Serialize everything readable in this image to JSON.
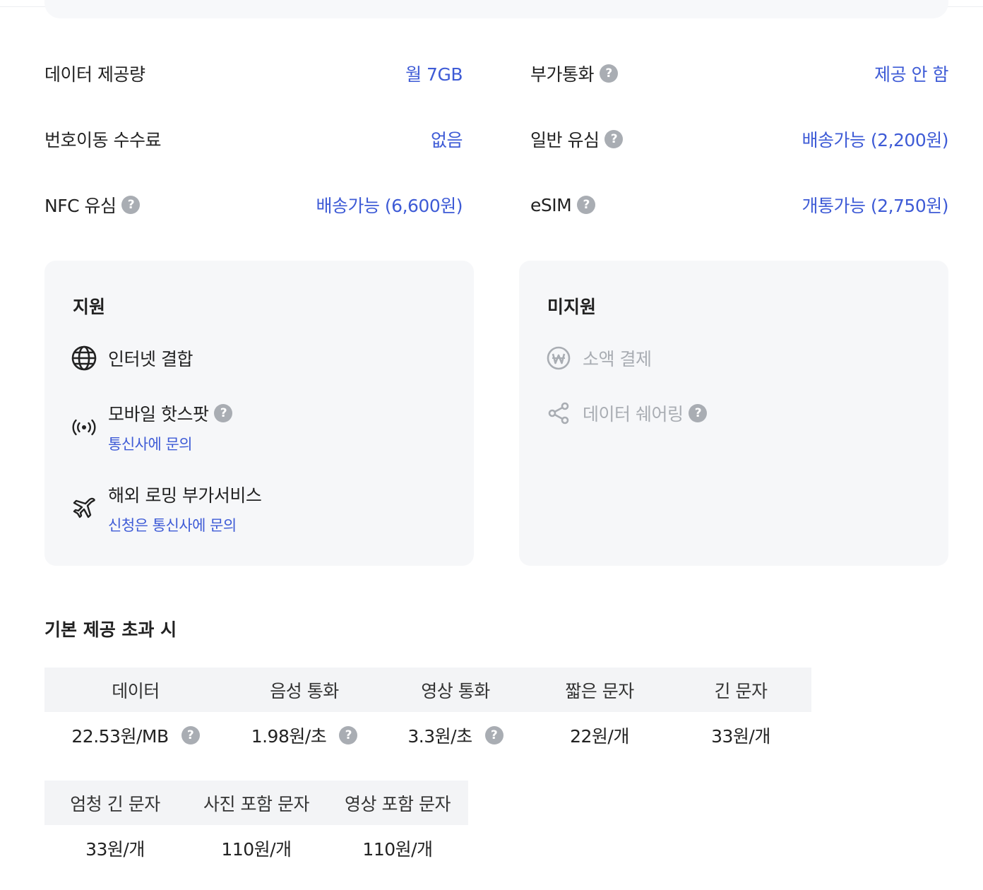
{
  "specs": {
    "data_amount": {
      "label": "데이터 제공량",
      "value": "월 7GB"
    },
    "extra_call": {
      "label": "부가통화",
      "value": "제공 안 함"
    },
    "port_fee": {
      "label": "번호이동 수수료",
      "value": "없음"
    },
    "general_usim": {
      "label": "일반 유심",
      "value": "배송가능 (2,200원)"
    },
    "nfc_usim": {
      "label": "NFC 유심",
      "value": "배송가능 (6,600원)"
    },
    "esim": {
      "label": "eSIM",
      "value": "개통가능 (2,750원)"
    }
  },
  "supported": {
    "title": "지원",
    "items": [
      {
        "name": "인터넷 결합",
        "note": "",
        "icon": "globe-icon"
      },
      {
        "name": "모바일 핫스팟",
        "note": "통신사에 문의",
        "icon": "broadcast-icon"
      },
      {
        "name": "해외 로밍 부가서비스",
        "note": "신청은 통신사에 문의",
        "icon": "airplane-icon"
      }
    ]
  },
  "unsupported": {
    "title": "미지원",
    "items": [
      {
        "name": "소액 결제",
        "icon": "won-coin-icon"
      },
      {
        "name": "데이터 쉐어링",
        "icon": "share-icon"
      }
    ]
  },
  "overage": {
    "title": "기본 제공 초과 시",
    "table1": {
      "headers": [
        "데이터",
        "음성 통화",
        "영상 통화",
        "짧은 문자",
        "긴 문자"
      ],
      "values": [
        "22.53원/MB",
        "1.98원/초",
        "3.3원/초",
        "22원/개",
        "33원/개"
      ]
    },
    "table2": {
      "headers": [
        "엄청 긴 문자",
        "사진 포함 문자",
        "영상 포함 문자"
      ],
      "values": [
        "33원/개",
        "110원/개",
        "110원/개"
      ]
    }
  },
  "help_glyph": "?",
  "colors": {
    "accent": "#3e5bd6",
    "help_icon": "#a9adb3",
    "panel_bg": "#f6f7f9",
    "header_bg": "#f3f4f6"
  }
}
